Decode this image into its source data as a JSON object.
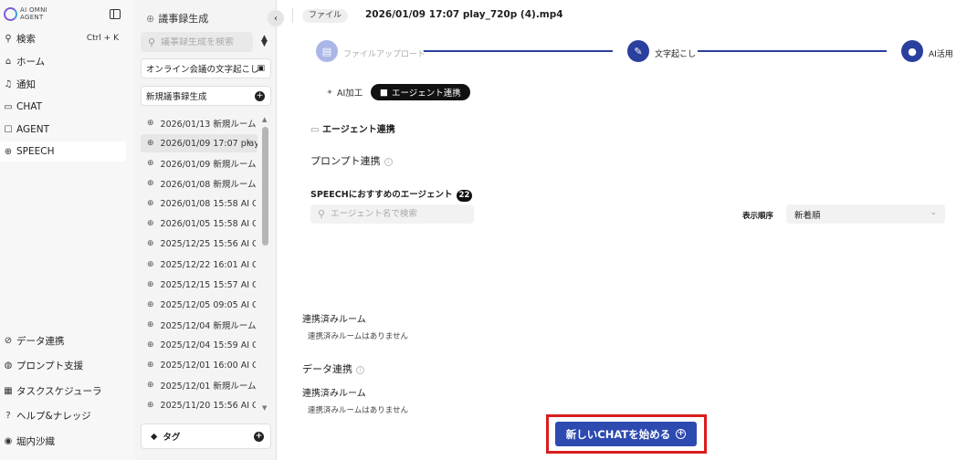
{
  "brand": {
    "line1": "AI OMNI",
    "line2": "AGENT"
  },
  "nav": {
    "search": {
      "label": "検索",
      "shortcut": "Ctrl + K"
    },
    "items": [
      {
        "label": "ホーム",
        "icon": "home-icon"
      },
      {
        "label": "通知",
        "icon": "bell-icon"
      },
      {
        "label": "CHAT",
        "icon": "chat-icon"
      },
      {
        "label": "AGENT",
        "icon": "robot-icon"
      },
      {
        "label": "SPEECH",
        "icon": "mic-icon"
      }
    ],
    "bottom": [
      {
        "label": "データ連携",
        "icon": "link-icon"
      },
      {
        "label": "プロンプト支援",
        "icon": "prompt-icon"
      },
      {
        "label": "タスクスケジューラ",
        "icon": "calendar-icon"
      },
      {
        "label": "ヘルプ&ナレッジ",
        "icon": "help-icon"
      },
      {
        "label": "堀内沙織",
        "icon": "user-icon"
      }
    ]
  },
  "list": {
    "title": "議事録生成",
    "search_placeholder": "議事録生成を検索",
    "online_btn": "オンライン会議の文字起こし",
    "new_btn": "新規議事録生成",
    "items": [
      "2026/01/13 新規ルーム",
      "2026/01/09 17:07 play_…",
      "2026/01/09 新規ルーム",
      "2026/01/08 新規ルーム #1",
      "2026/01/08 15:58 AI OM…",
      "2026/01/05 15:58 AI OM…",
      "2025/12/25 15:56 AI OM…",
      "2025/12/22 16:01 AI OM…",
      "2025/12/15 15:57 AI OM…",
      "2025/12/05 09:05 AI OM…",
      "2025/12/04 新規ルーム #1",
      "2025/12/04 15:59 AI OM…",
      "2025/12/01 16:00 AI OM…",
      "2025/12/01 新規ルーム",
      "2025/11/20 15:56 AI OM…"
    ],
    "tag_label": "タグ"
  },
  "main": {
    "file_chip": "ファイル",
    "file_name": "2026/01/09 17:07 play_720p (4).mp4",
    "steps": [
      {
        "label": "ファイルアップロード",
        "state": "done"
      },
      {
        "label": "文字起こし",
        "state": "active"
      },
      {
        "label": "AI活用",
        "state": "active"
      }
    ],
    "tabs": [
      {
        "label": "AI加工",
        "selected": false
      },
      {
        "label": "エージェント連携",
        "selected": true
      }
    ],
    "agent_link_heading": "エージェント連携",
    "prompt_link_heading": "プロンプト連携",
    "recommend_heading": "SPEECHにおすすめのエージェント",
    "recommend_count": "22",
    "agent_search_placeholder": "エージェント名で検索",
    "sort_label": "表示順序",
    "sort_value": "新着順",
    "linked_rooms_1": "連携済みルーム",
    "no_linked_rooms_1": "連携済みルームはありません",
    "data_link_heading": "データ連携",
    "linked_rooms_2": "連携済みルーム",
    "no_linked_rooms_2": "連携済みルームはありません",
    "cta_label": "新しいCHATを始める"
  },
  "colors": {
    "accent": "#2d4ab0",
    "highlight": "#d81e1e",
    "step_done": "#aab6e6"
  }
}
